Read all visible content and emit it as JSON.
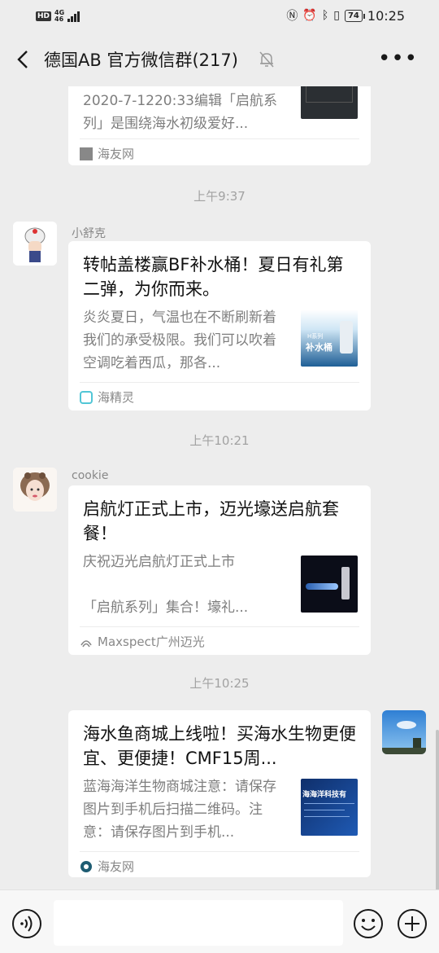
{
  "status_bar": {
    "hd": "HD",
    "network": "4G",
    "network_sub": "46",
    "battery": "74",
    "time": "10:25"
  },
  "nav": {
    "title": "德国AB  官方微信群(217)"
  },
  "messages": [
    {
      "desc": "2020-7-1220:33编辑「启航系列」是围绕海水初级爱好...",
      "source": "海友网"
    },
    {
      "time": "上午9:37",
      "sender": "小舒克",
      "title": "转帖盖楼赢BF补水桶！夏日有礼第二弹，为你而来。",
      "desc": "炎炎夏日，气温也在不断刷新着我们的承受极限。我们可以吹着空调吃着西瓜，那各...",
      "source": "海精灵",
      "thumb_text": "补水桶",
      "thumb_sub": "H系列"
    },
    {
      "time": "上午10:21",
      "sender": "cookie",
      "title": "启航灯正式上市，迈光壕送启航套餐！",
      "desc": "庆祝迈光启航灯正式上市\n\n「启航系列」集合！壕礼...",
      "source": "Maxspect广州迈光"
    },
    {
      "time": "上午10:25",
      "title": "海水鱼商城上线啦！买海水生物更便宜、更便捷！CMF15周...",
      "desc": "蓝海海洋生物商城注意：请保存图片到手机后扫描二维码。注意：请保存图片到手机...",
      "source": "海友网",
      "thumb_text": "海海洋科技有"
    }
  ],
  "input": {
    "placeholder": ""
  },
  "colors": {
    "background": "#ededed",
    "card": "#ffffff",
    "muted_text": "#7e7e7e"
  }
}
